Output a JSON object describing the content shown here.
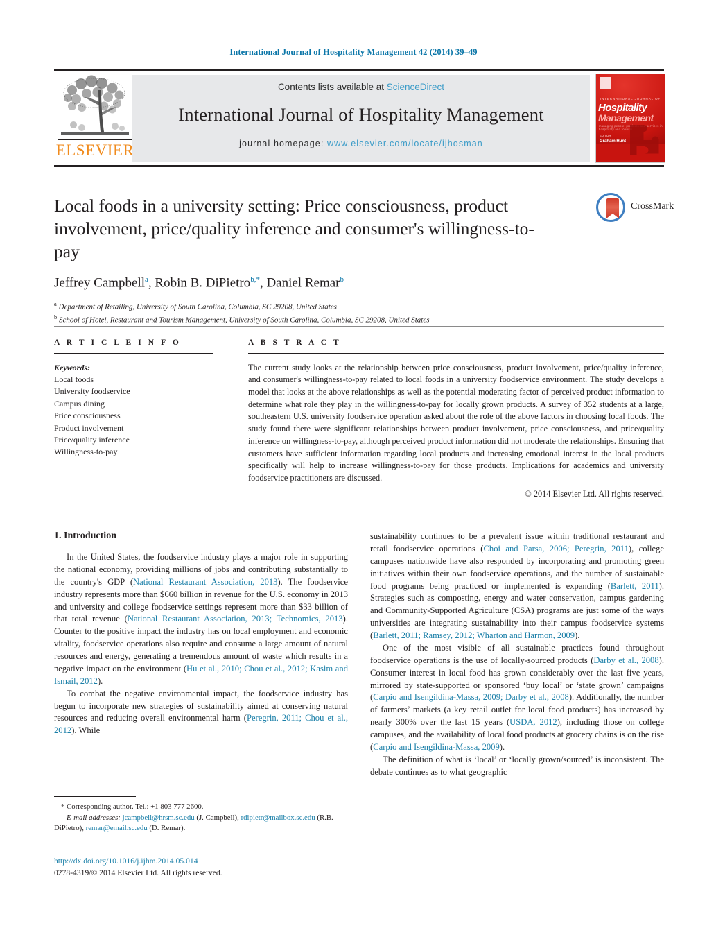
{
  "running_head": "International Journal of Hospitality Management 42 (2014) 39–49",
  "masthead": {
    "publisher_name": "ELSEVIER",
    "contents_prefix": "Contents lists available at ",
    "contents_link": "ScienceDirect",
    "journal_name": "International Journal of Hospitality Management",
    "homepage_prefix": "journal homepage: ",
    "homepage_url": "www.elsevier.com/locate/ijhosman",
    "cover": {
      "kicker": "INTERNATIONAL JOURNAL OF",
      "line1": "Hospitality",
      "line2": "Management",
      "subline": "managing people, products and services in hospitality and tourism",
      "editor_label": "EDITOR",
      "editor_name": "Graham Hunt"
    }
  },
  "article": {
    "title": "Local foods in a university setting: Price consciousness, product involvement, price/quality inference and consumer's willingness-to-pay",
    "crossmark_label": "CrossMark",
    "authors": "Jeffrey Campbell, Robin B. DiPietro, Daniel Remar",
    "affiliations": [
      "Department of Retailing, University of South Carolina, Columbia, SC 29208, United States",
      "School of Hotel, Restaurant and Tourism Management, University of South Carolina, Columbia, SC 29208, United States"
    ]
  },
  "article_info": {
    "heading": "A R T I C L E    I N F O",
    "keywords_label": "Keywords:",
    "keywords": [
      "Local foods",
      "University foodservice",
      "Campus dining",
      "Price consciousness",
      "Product involvement",
      "Price/quality inference",
      "Willingness-to-pay"
    ]
  },
  "abstract": {
    "heading": "A B S T R A C T",
    "text": "The current study looks at the relationship between price consciousness, product involvement, price/quality inference, and consumer's willingness-to-pay related to local foods in a university foodservice environment. The study develops a model that looks at the above relationships as well as the potential moderating factor of perceived product information to determine what role they play in the willingness-to-pay for locally grown products. A survey of 352 students at a large, southeastern U.S. university foodservice operation asked about the role of the above factors in choosing local foods. The study found there were significant relationships between product involvement, price consciousness, and price/quality inference on willingness-to-pay, although perceived product information did not moderate the relationships. Ensuring that customers have sufficient information regarding local products and increasing emotional interest in the local products specifically will help to increase willingness-to-pay for those products. Implications for academics and university foodservice practitioners are discussed.",
    "copyright": "© 2014 Elsevier Ltd. All rights reserved."
  },
  "body": {
    "section_heading": "1.  Introduction",
    "left_paragraphs": [
      "In the United States, the foodservice industry plays a major role in supporting the national economy, providing millions of jobs and contributing substantially to the country's GDP (National Restaurant Association, 2013). The foodservice industry represents more than $660 billion in revenue for the U.S. economy in 2013 and university and college foodservice settings represent more than $33 billion of that total revenue (National Restaurant Association, 2013; Technomics, 2013). Counter to the positive impact the industry has on local employment and economic vitality, foodservice operations also require and consume a large amount of natural resources and energy, generating a tremendous amount of waste which results in a negative impact on the environment (Hu et al., 2010; Chou et al., 2012; Kasim and Ismail, 2012).",
      "To combat the negative environmental impact, the foodservice industry has begun to incorporate new strategies of sustainability aimed at conserving natural resources and reducing overall environmental harm (Peregrin, 2011; Chou et al., 2012). While"
    ],
    "right_paragraphs": [
      "sustainability continues to be a prevalent issue within traditional restaurant and retail foodservice operations (Choi and Parsa, 2006; Peregrin, 2011), college campuses nationwide have also responded by incorporating and promoting green initiatives within their own foodservice operations, and the number of sustainable food programs being practiced or implemented is expanding (Barlett, 2011). Strategies such as composting, energy and water conservation, campus gardening and Community-Supported Agriculture (CSA) programs are just some of the ways universities are integrating sustainability into their campus foodservice systems (Barlett, 2011; Ramsey, 2012; Wharton and Harmon, 2009).",
      "One of the most visible of all sustainable practices found throughout foodservice operations is the use of locally-sourced products (Darby et al., 2008). Consumer interest in local food has grown considerably over the last five years, mirrored by state-supported or sponsored 'buy local' or 'state grown' campaigns (Carpio and Isengildina-Massa, 2009; Darby et al., 2008). Additionally, the number of farmers' markets (a key retail outlet for local food products) has increased by nearly 300% over the last 15 years (USDA, 2012), including those on college campuses, and the availability of local food products at grocery chains is on the rise (Carpio and Isengildina-Massa, 2009).",
      "The definition of what is 'local' or 'locally grown/sourced' is inconsistent. The debate continues as to what geographic"
    ]
  },
  "footnotes": {
    "corresponding": "* Corresponding author. Tel.: +1 803 777 2600.",
    "email_label": "E-mail addresses:",
    "emails": [
      {
        "address": "jcampbell@hrsm.sc.edu",
        "owner": "(J. Campbell)"
      },
      {
        "address": "rdipietr@mailbox.sc.edu",
        "owner": "(R.B. DiPietro)"
      },
      {
        "address": "remar@email.sc.edu",
        "owner": "(D. Remar)"
      }
    ],
    "doi": "http://dx.doi.org/10.1016/j.ijhm.2014.05.014",
    "issn_line": "0278-4319/© 2014 Elsevier Ltd. All rights reserved."
  },
  "colors": {
    "link_blue": "#1a7fa8",
    "runhead_blue": "#0b76a8",
    "elsevier_orange": "#f08b1d",
    "masthead_grey": "#e7e8ea",
    "cover_red": "#c8140f"
  }
}
